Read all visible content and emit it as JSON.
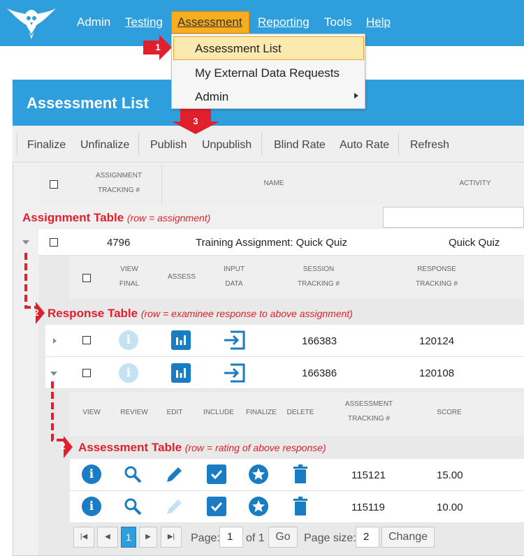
{
  "nav": {
    "items": [
      "Admin",
      "Testing",
      "Assessment",
      "Reporting",
      "Tools",
      "Help"
    ]
  },
  "dropdown": {
    "items": [
      "Assessment List",
      "My External Data Requests",
      "Admin"
    ]
  },
  "panel": {
    "title": "Assessment List"
  },
  "toolbar": {
    "buttons": [
      "Finalize",
      "Unfinalize",
      "Publish",
      "Unpublish",
      "Blind Rate",
      "Auto Rate",
      "Refresh"
    ]
  },
  "assignment_table": {
    "headers": {
      "tracking_1": "ASSIGNMENT",
      "tracking_2": "TRACKING #",
      "name": "NAME",
      "activity": "ACTIVITY"
    },
    "label": "Assignment Table",
    "sublabel": "(row = assignment)",
    "row": {
      "tracking": "4796",
      "name": "Training Assignment: Quick Quiz",
      "activity": "Quick Quiz"
    }
  },
  "response_table": {
    "headers": {
      "view_1": "VIEW",
      "view_2": "FINAL",
      "assess": "ASSESS",
      "input_1": "INPUT",
      "input_2": "DATA",
      "session_1": "SESSION",
      "session_2": "TRACKING #",
      "response_1": "RESPONSE",
      "response_2": "TRACKING #"
    },
    "label": "Response Table",
    "sublabel": "(row = examinee response to above assignment)",
    "rows": [
      {
        "session": "166383",
        "response": "120124"
      },
      {
        "session": "166386",
        "response": "120108"
      }
    ]
  },
  "assessment_table": {
    "headers": {
      "view": "VIEW",
      "review": "REVIEW",
      "edit": "EDIT",
      "include": "INCLUDE",
      "finalize": "FINALIZE",
      "delete": "DELETE",
      "tracking_1": "ASSESSMENT",
      "tracking_2": "TRACKING #",
      "score": "SCORE"
    },
    "label": "Assessment Table",
    "sublabel": "(row = rating of above response)",
    "rows": [
      {
        "tracking": "115121",
        "score": "15.00"
      },
      {
        "tracking": "115119",
        "score": "10.00"
      }
    ]
  },
  "pager": {
    "current_page": "1",
    "page_label": "Page:",
    "page_value": "1",
    "of_label": "of 1",
    "go_label": "Go",
    "size_label": "Page size:",
    "size_value": "2",
    "change_label": "Change"
  },
  "callouts": {
    "one": "1",
    "two": "2",
    "three": "3"
  },
  "colors": {
    "brand_blue": "#2e9fdc",
    "highlight_orange": "#f7ad1e",
    "annotation_red": "#e0202c",
    "icon_blue": "#1a7cc3",
    "icon_disabled": "#c5e2f3"
  }
}
